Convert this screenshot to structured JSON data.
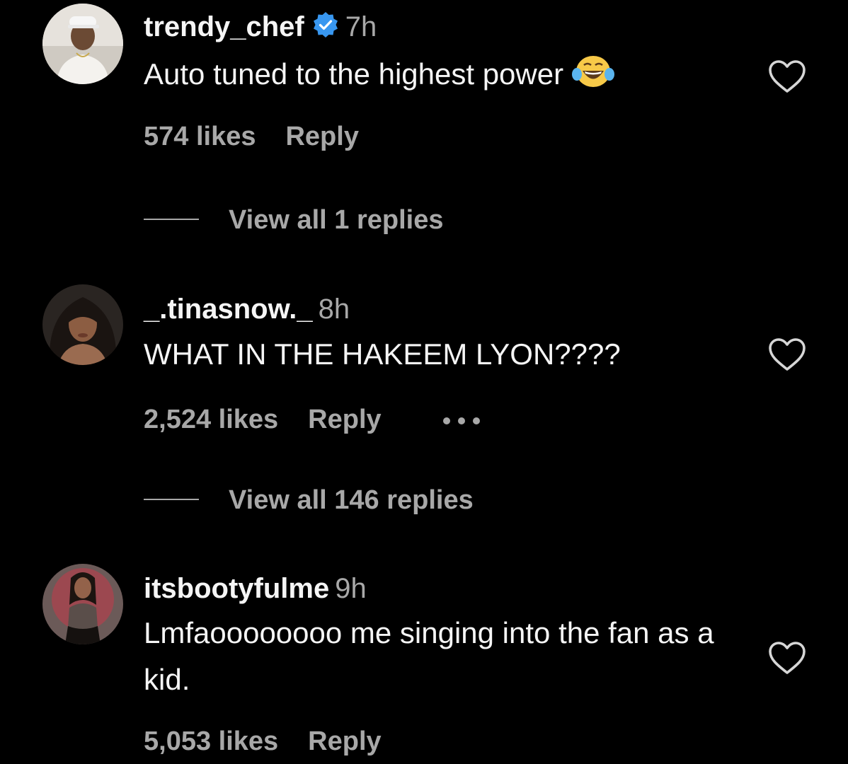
{
  "comments": [
    {
      "username": "trendy_chef",
      "verified": true,
      "time": "7h",
      "text": "Auto tuned to the highest power",
      "emoji": "face-with-tears-of-joy",
      "likes": "574 likes",
      "reply_label": "Reply",
      "view_replies": "View all 1 replies"
    },
    {
      "username": "_.tinasnow._",
      "verified": false,
      "time": "8h",
      "text": "WHAT IN THE HAKEEM LYON????",
      "likes": "2,524 likes",
      "reply_label": "Reply",
      "more_icon": "ellipsis-icon",
      "view_replies": "View all 146 replies"
    },
    {
      "username": "itsbootyfulme",
      "verified": false,
      "time": "9h",
      "text": "Lmfaoooooooo me singing into the fan as a kid.",
      "likes": "5,053 likes",
      "reply_label": "Reply"
    }
  ],
  "colors": {
    "background": "#000000",
    "primary_text": "#f5f5f5",
    "secondary_text": "#a8a8a8",
    "verified_badge": "#3897f0"
  }
}
